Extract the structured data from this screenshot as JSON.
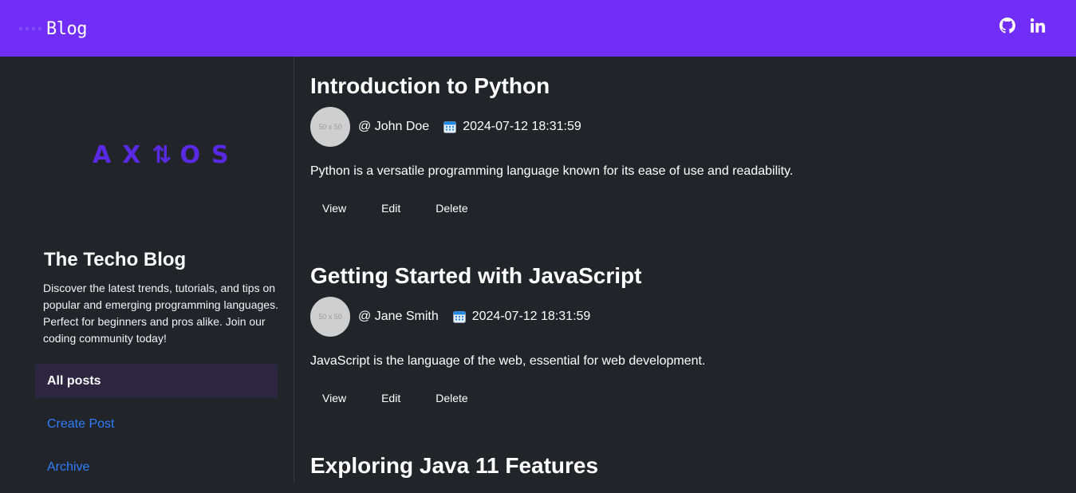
{
  "navbar": {
    "brand": "Blog",
    "colors": {
      "background": "#722ef9"
    },
    "icons": [
      "github-icon",
      "linkedin-icon"
    ]
  },
  "sidebar": {
    "logo_text": "AX1OS",
    "title": "The Techo Blog",
    "description": "Discover the latest trends, tutorials, and tips on popular and emerging programming languages. Perfect for beginners and pros alike. Join our coding community today!",
    "nav": [
      {
        "label": "All posts",
        "active": true
      },
      {
        "label": "Create Post",
        "active": false
      },
      {
        "label": "Archive",
        "active": false
      }
    ]
  },
  "posts": [
    {
      "title": "Introduction to Python",
      "avatar_text": "50 x 50",
      "author": "@ John Doe",
      "date": "2024-07-12 18:31:59",
      "summary": "Python is a versatile programming language known for its ease of use and readability.",
      "actions": {
        "view": "View",
        "edit": "Edit",
        "delete": "Delete"
      }
    },
    {
      "title": "Getting Started with JavaScript",
      "avatar_text": "50 x 50",
      "author": "@ Jane Smith",
      "date": "2024-07-12 18:31:59",
      "summary": "JavaScript is the language of the web, essential for web development.",
      "actions": {
        "view": "View",
        "edit": "Edit",
        "delete": "Delete"
      }
    },
    {
      "title": "Exploring Java 11 Features"
    }
  ],
  "colors": {
    "page_background": "#212529",
    "accent": "#722ef9",
    "link": "#2f7dff",
    "logo": "#5a29e4"
  }
}
